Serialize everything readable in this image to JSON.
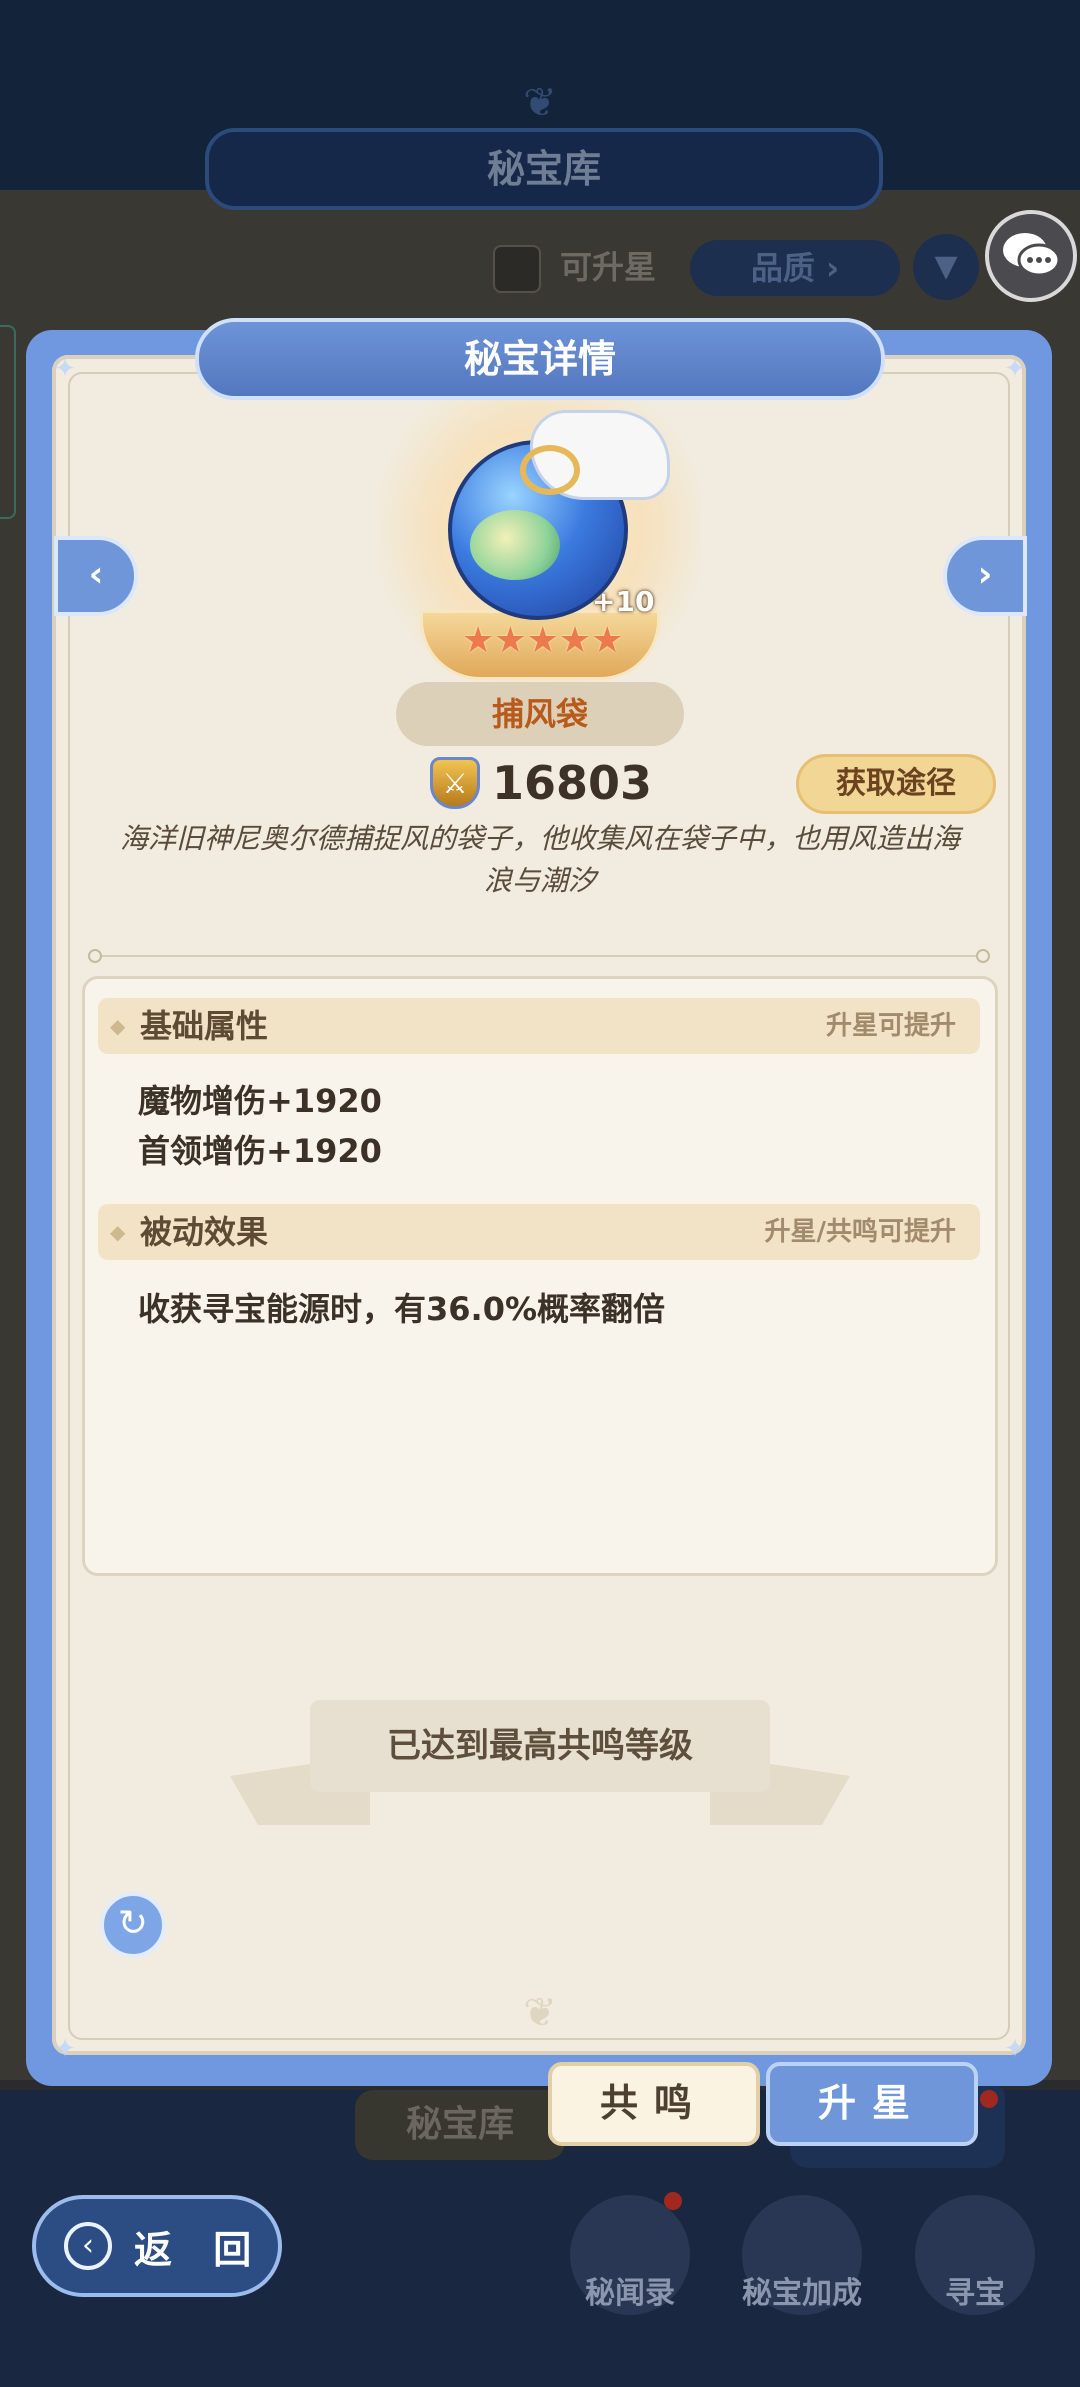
{
  "background": {
    "window_title": "秘宝库",
    "checkbox_label": "可升星",
    "quality_button": "品质",
    "bottom_tab_vault": "秘宝库",
    "nav": [
      {
        "label": "秘闻录",
        "icon": "scroll-icon"
      },
      {
        "label": "秘宝加成",
        "icon": "sparkle-icon"
      },
      {
        "label": "寻宝",
        "icon": "treasure-chest-icon"
      }
    ],
    "back_label": "返 回"
  },
  "dialog": {
    "title": "秘宝详情",
    "item": {
      "name": "捕风袋",
      "level": "+10",
      "stars": 5,
      "power": "16803",
      "description": "海洋旧神尼奥尔德捕捉风的袋子，他收集风在袋子中，也用风造出海浪与潮汐"
    },
    "source_button": "获取途径",
    "base_attributes": {
      "title": "基础属性",
      "hint": "升星可提升",
      "lines": [
        "魔物增伤+1920",
        "首领增伤+1920"
      ]
    },
    "passive_effect": {
      "title": "被动效果",
      "hint": "升星/共鸣可提升",
      "lines": [
        "收获寻宝能源时，有36.0%概率翻倍"
      ]
    },
    "max_banner": "已达到最高共鸣等级",
    "tabs": {
      "resonance": "共鸣",
      "star_up": "升星"
    }
  },
  "colors": {
    "frame_blue": "#6f98e0",
    "parchment": "#f1ecdf",
    "gold_button": "#f2d695",
    "name_text": "#b85a1c"
  }
}
